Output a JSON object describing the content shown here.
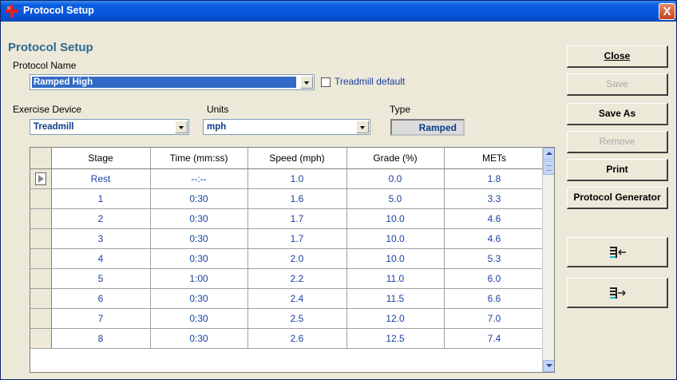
{
  "window": {
    "title": "Protocol Setup",
    "close_glyph": "X"
  },
  "heading": "Protocol Setup",
  "protocol_name": {
    "label": "Protocol Name",
    "value": "Ramped High"
  },
  "treadmill_default": {
    "label": "Treadmill default",
    "checked": false
  },
  "exercise_device": {
    "label": "Exercise Device",
    "value": "Treadmill"
  },
  "units": {
    "label": "Units",
    "value": "mph"
  },
  "type": {
    "label": "Type",
    "value": "Ramped"
  },
  "grid": {
    "columns": [
      "Stage",
      "Time (mm:ss)",
      "Speed (mph)",
      "Grade (%)",
      "METs"
    ],
    "rows": [
      [
        "Rest",
        "--:--",
        "1.0",
        "0.0",
        "1.8"
      ],
      [
        "1",
        "0:30",
        "1.6",
        "5.0",
        "3.3"
      ],
      [
        "2",
        "0:30",
        "1.7",
        "10.0",
        "4.6"
      ],
      [
        "3",
        "0:30",
        "1.7",
        "10.0",
        "4.6"
      ],
      [
        "4",
        "0:30",
        "2.0",
        "10.0",
        "5.3"
      ],
      [
        "5",
        "1:00",
        "2.2",
        "11.0",
        "6.0"
      ],
      [
        "6",
        "0:30",
        "2.4",
        "11.5",
        "6.6"
      ],
      [
        "7",
        "0:30",
        "2.5",
        "12.0",
        "7.0"
      ],
      [
        "8",
        "0:30",
        "2.6",
        "12.5",
        "7.4"
      ]
    ]
  },
  "buttons": {
    "close": "Close",
    "save": "Save",
    "save_as": "Save As",
    "remove": "Remove",
    "print": "Print",
    "protocol_generator": "Protocol Generator"
  },
  "icons": {
    "import": "insert-stage-icon",
    "export": "append-stage-icon"
  },
  "colors": {
    "heading": "#2c6a90",
    "cell_text": "#1a3fa0",
    "selection": "#316ac5",
    "titlebar": "#0654d8"
  }
}
